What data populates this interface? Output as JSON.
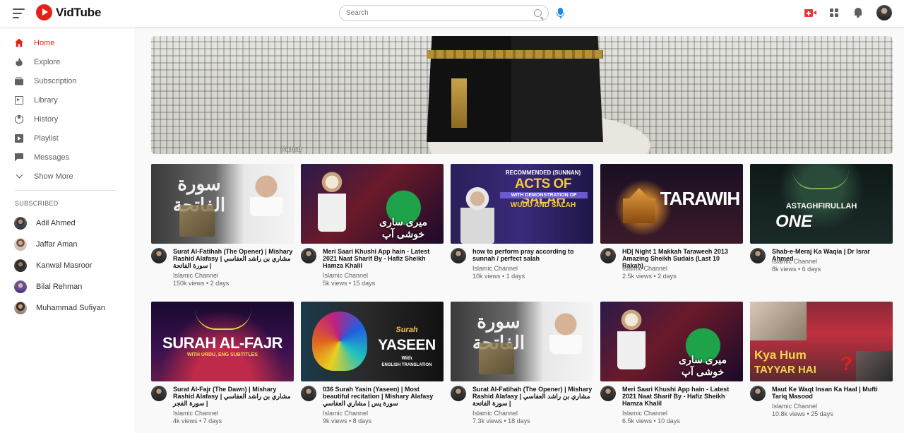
{
  "app": {
    "name": "VidTube",
    "brand_color": "#e62117"
  },
  "header": {
    "search_placeholder": "Search",
    "icons": [
      "menu-icon",
      "search-icon",
      "mic-icon",
      "create-video-icon",
      "apps-icon",
      "notifications-icon",
      "user-avatar"
    ]
  },
  "sidebar": {
    "items": [
      {
        "label": "Home",
        "icon": "home-icon",
        "active": true
      },
      {
        "label": "Explore",
        "icon": "explore-icon",
        "active": false
      },
      {
        "label": "Subscription",
        "icon": "subscription-icon",
        "active": false
      },
      {
        "label": "Library",
        "icon": "library-icon",
        "active": false
      },
      {
        "label": "History",
        "icon": "history-icon",
        "active": false
      },
      {
        "label": "Playlist",
        "icon": "playlist-icon",
        "active": false
      },
      {
        "label": "Messages",
        "icon": "messages-icon",
        "active": false
      },
      {
        "label": "Show More",
        "icon": "chevron-down-icon",
        "active": false
      }
    ],
    "subscribed_title": "SUBSCRIBED",
    "subscriptions": [
      {
        "name": "Adil Ahmed"
      },
      {
        "name": "Jaffar Aman"
      },
      {
        "name": "Kanwal Masroor"
      },
      {
        "name": "Bilal Rehman"
      },
      {
        "name": "Muhammad Sufiyan"
      }
    ]
  },
  "banner": {
    "caption": "Naimat"
  },
  "videos": [
    {
      "title": "Surat Al-Fatihah (The Opener) | Mishary Rashid Alafasy | مشاري بن راشد العفاسي | سورة الفاتحة",
      "channel": "Islamic Channel",
      "stats": "150k views • 2 days",
      "thumb_text": "سورة الفاتحة"
    },
    {
      "title": "Meri Saari Khushi App hain - Latest 2021 Naat Sharif By - Hafiz Sheikh Hamza Khalil",
      "channel": "Islamic Channel",
      "stats": "5k views • 15 days",
      "thumb_text": "میری ساری خوشی آپ"
    },
    {
      "title": "how to perform pray according to sunnah / perfect salah",
      "channel": "Islamic Channel",
      "stats": "10k views • 1 days",
      "thumb_text_1": "RECOMMENDED (SUNNAN)",
      "thumb_text_2": "ACTS OF SALAH",
      "thumb_text_3": "WITH DEMONSTRATION OF",
      "thumb_text_4": "WUDU AND SALAH"
    },
    {
      "title": "HD| Night 1 Makkah Taraweeh 2013 Amazing Sheikh Sudais (Last 10 Rakah)",
      "channel": "Islamic Channel",
      "stats": "2.5k views • 2 days",
      "thumb_text": "TARAWIH"
    },
    {
      "title": "Shab-e-Meraj Ka Waqia | Dr Israr Ahmed",
      "channel": "Islamic Channel",
      "stats": "8k views • 6 days",
      "thumb_text_1": "ASTAGHFIRULLAH",
      "thumb_text_2": "ONE"
    },
    {
      "title": "Surat Al-Fajr (The Dawn) | Mishary Rashid Alafasy | مشاري بن راشد العفاسي | سورة الفجر",
      "channel": "Islamic Channel",
      "stats": "4k views • 7 days",
      "thumb_text_1": "SURAH AL-FAJR",
      "thumb_text_2": "WITH URDU, ENG SUBTITLES"
    },
    {
      "title": "036 Surah Yasin (Yaseen) | Most beautiful recitation | Mishary Alafasy سورة يس | مشاري العفاسي",
      "channel": "Islamic Channel",
      "stats": "9k views • 8 days",
      "thumb_text_1": "Surah",
      "thumb_text_2": "YASEEN",
      "thumb_text_3": "With",
      "thumb_text_4": "ENGLISH TRANSLATION"
    },
    {
      "title": "Surat Al-Fatihah (The Opener) | Mishary Rashid Alafasy | مشاري بن راشد العفاسي | سورة الفاتحة",
      "channel": "Islamic Channel",
      "stats": "7.3k views • 18 days",
      "thumb_text": "سورة الفاتحة"
    },
    {
      "title": "Meri Saari Khushi App hain - Latest 2021 Naat Sharif By - Hafiz Sheikh Hamza Khalil",
      "channel": "Islamic Channel",
      "stats": "6.5k views • 10 days",
      "thumb_text": "میری ساری خوشی آپ"
    },
    {
      "title": "Maut Ke Waqt Insan Ka Haal | Mufti Tariq Masood",
      "channel": "Islamic Channel",
      "stats": "10.8k views • 25 days",
      "thumb_text_1": "Kya Hum",
      "thumb_text_2": "TAYYAR HAI"
    }
  ]
}
